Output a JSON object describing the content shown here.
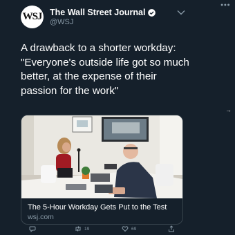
{
  "account": {
    "avatar_text": "WSJ",
    "name": "The Wall Street Journal",
    "handle": "@WSJ"
  },
  "tweet": {
    "lines": [
      "A drawback to a shorter workday:",
      "\"Everyone's outside life got so much",
      "better, at the expense of their",
      "passion for the work\""
    ]
  },
  "card": {
    "title": "The 5-Hour Workday Gets Put to the Test",
    "domain": "wsj.com",
    "image_subject": "office-photo"
  },
  "actions": {
    "retweets": "19",
    "likes": "69"
  },
  "icons": {
    "verified": "verified-badge-icon",
    "more": "chevron-down-icon",
    "reply": "reply-icon",
    "retweet": "retweet-icon",
    "like": "heart-icon",
    "share": "share-icon"
  },
  "colors": {
    "background": "#15202b",
    "secondary_text": "#8899a6",
    "verified": "#ffffff"
  }
}
